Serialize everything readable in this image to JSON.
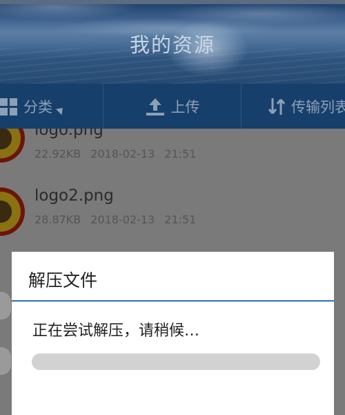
{
  "header": {
    "title": "我的资源"
  },
  "toolbar": {
    "category_label": "分类",
    "upload_label": "上传",
    "transfer_label": "传输列表"
  },
  "files": [
    {
      "name": "logo.png",
      "size": "22.92KB",
      "date": "2018-02-13",
      "time": "21:51"
    },
    {
      "name": "logo2.png",
      "size": "28.87KB",
      "date": "2018-02-13",
      "time": "21:51"
    }
  ],
  "dialog": {
    "title": "解压文件",
    "message": "正在尝试解压，请稍候…",
    "progress": 0
  },
  "colors": {
    "toolbar_bg": "#173f6b",
    "accent": "#2e6fb7",
    "overlay": "#7a7a7a"
  }
}
